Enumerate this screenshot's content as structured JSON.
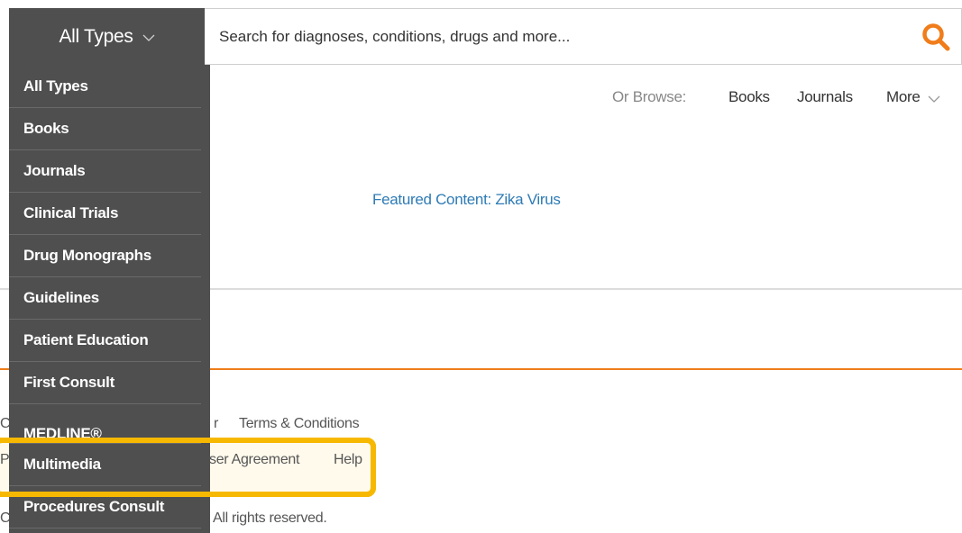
{
  "search": {
    "type_selector_label": "All Types",
    "placeholder": "Search for diagnoses, conditions, drugs and more..."
  },
  "browse": {
    "label": "Or Browse:",
    "books": "Books",
    "journals": "Journals",
    "more": "More"
  },
  "featured": {
    "link": "Featured Content: Zika Virus"
  },
  "dropdown": {
    "items": [
      "All Types",
      "Books",
      "Journals",
      "Clinical Trials",
      "Drug Monographs",
      "Guidelines",
      "Patient Education",
      "First Consult",
      "MEDLINE®",
      "Multimedia",
      "Procedures Consult"
    ]
  },
  "footer": {
    "terms": "Terms & Conditions",
    "user_agreement": "ser Agreement",
    "help": "Help",
    "rights": "All rights reserved.",
    "left_fragment_1": "Pr",
    "left_fragment_2": "C",
    "left_fragment_0": "C",
    "r_fragment": "r"
  },
  "colors": {
    "accent": "#f07d1a",
    "link": "#2e7bb5",
    "dropdown_bg": "#4f4f4f",
    "highlight": "#f7b801"
  }
}
